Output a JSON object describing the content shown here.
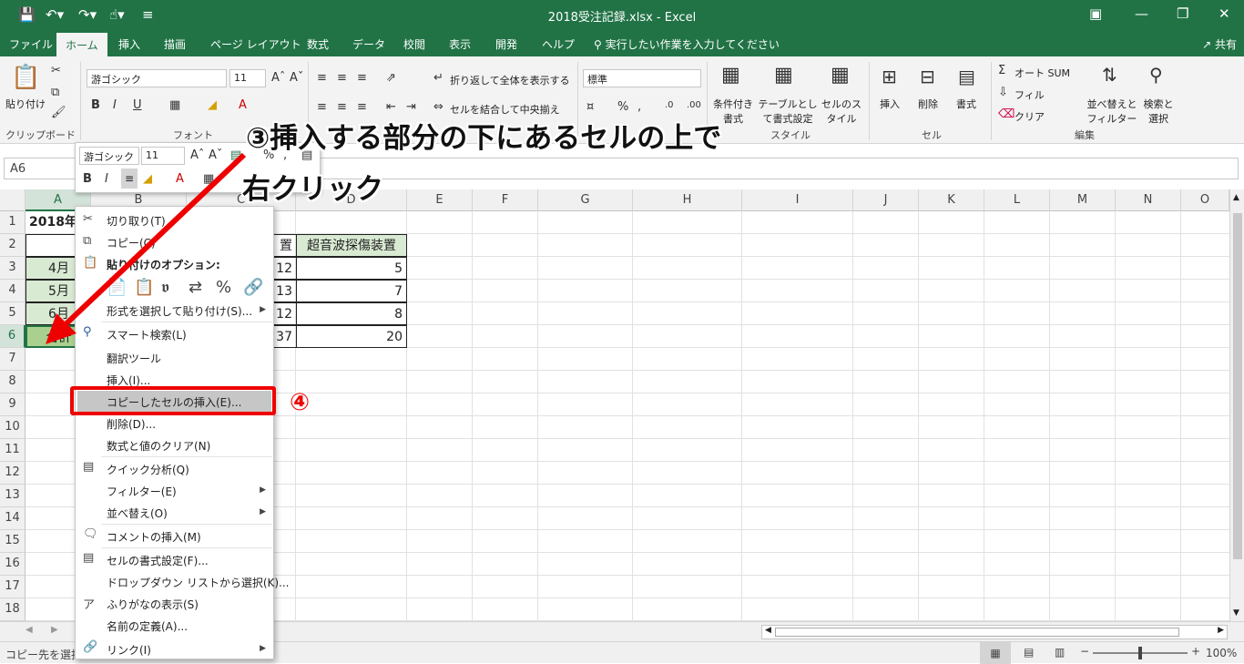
{
  "window": {
    "title": "2018受注記録.xlsx  -  Excel"
  },
  "tabs": [
    "ファイル",
    "ホーム",
    "挿入",
    "描画",
    "ページ レイアウト",
    "数式",
    "データ",
    "校閲",
    "表示",
    "開発",
    "ヘルプ"
  ],
  "active_tab": "ホーム",
  "tellme": "実行したい作業を入力してください",
  "share": "共有",
  "ribbon": {
    "paste": "貼り付け",
    "font_name": "游ゴシック",
    "font_size": "11",
    "wrap": "折り返して全体を表示する",
    "merge": "セルを結合して中央揃え",
    "number_format": "標準",
    "cond_format": "条件付き書式",
    "table_format": "テーブルとして書式設定",
    "cell_style": "セルのスタイル",
    "insert": "挿入",
    "delete": "削除",
    "format": "書式",
    "autosum": "オート SUM",
    "fill": "フィル",
    "clear": "クリア",
    "sort": "並べ替えとフィルター",
    "find": "検索と選択",
    "groups": {
      "clipboard": "クリップボード",
      "font": "フォント",
      "style": "スタイル",
      "cells": "セル",
      "edit": "編集"
    }
  },
  "namebox": "A6",
  "columns": [
    "A",
    "B",
    "C",
    "D",
    "E",
    "F",
    "G",
    "H",
    "I",
    "J",
    "K",
    "L",
    "M",
    "N",
    "O"
  ],
  "rows": [
    "1",
    "2",
    "3",
    "4",
    "5",
    "6",
    "7",
    "8",
    "9",
    "10",
    "11",
    "12",
    "13",
    "14",
    "15",
    "16",
    "17",
    "18"
  ],
  "cells": {
    "a1": "2018年",
    "c2": "置",
    "d2": "超音波探傷装置",
    "a3": "4月",
    "c3": "12",
    "d3": "5",
    "a4": "5月",
    "c4": "13",
    "d4": "7",
    "a5": "6月",
    "c5": "12",
    "d5": "8",
    "a6": "合計",
    "c6": "37",
    "d6": "20"
  },
  "mini_toolbar": {
    "font": "游ゴシック",
    "size": "11"
  },
  "context_menu": {
    "cut": "切り取り(T)",
    "copy": "コピー(C)",
    "paste_options": "貼り付けのオプション:",
    "paste_special": "形式を選択して貼り付け(S)...",
    "smart_lookup": "スマート検索(L)",
    "translate": "翻訳ツール",
    "insert": "挿入(I)...",
    "insert_copied": "コピーしたセルの挿入(E)...",
    "delete": "削除(D)...",
    "clear": "数式と値のクリア(N)",
    "quick_analysis": "クイック分析(Q)",
    "filter": "フィルター(E)",
    "sort": "並べ替え(O)",
    "insert_comment": "コメントの挿入(M)",
    "format_cells": "セルの書式設定(F)...",
    "dropdown": "ドロップダウン リストから選択(K)...",
    "phonetic": "ふりがなの表示(S)",
    "define_name": "名前の定義(A)...",
    "link": "リンク(I)"
  },
  "annotations": {
    "step3_line1": "③挿入する部分の下にあるセルの上で",
    "step3_line2": "右クリック",
    "step4": "④"
  },
  "status": {
    "left": "コピー先を選択",
    "zoom": "100%"
  },
  "colors": {
    "excel_green": "#217346",
    "highlight_red": "#e00000",
    "cell_green": "#d9ead3"
  }
}
